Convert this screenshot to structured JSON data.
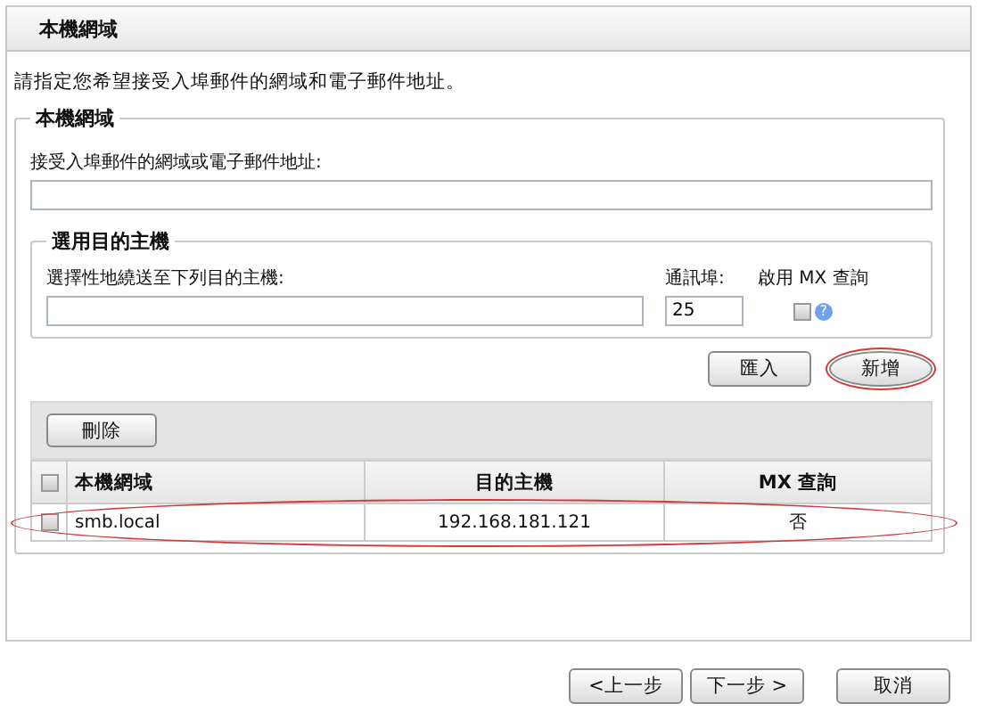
{
  "panel": {
    "title": "本機網域",
    "instruction": "請指定您希望接受入埠郵件的網域和電子郵件地址。"
  },
  "local_domain": {
    "legend": "本機網域",
    "label": "接受入埠郵件的網域或電子郵件地址:"
  },
  "destination": {
    "legend": "選用目的主機",
    "host_label": "選擇性地繞送至下列目的主機:",
    "port_label": "通訊埠:",
    "port_value": "25",
    "mx_label": "啟用 MX 查詢",
    "mx_checked": false,
    "help": "?"
  },
  "actions": [
    {
      "label": "匯入",
      "highlighted": false
    },
    {
      "label": "新增",
      "highlighted": true
    }
  ],
  "table": {
    "delete_button": "刪除",
    "all_checked": false,
    "columns": [
      "本機網域",
      "目的主機",
      "MX 查詢"
    ],
    "rows": [
      {
        "checked": false,
        "highlighted": true,
        "cells": [
          "smb.local",
          "192.168.181.121",
          "否"
        ]
      }
    ]
  },
  "footer_buttons": [
    "<上一步",
    "下一步 >",
    "取消"
  ]
}
